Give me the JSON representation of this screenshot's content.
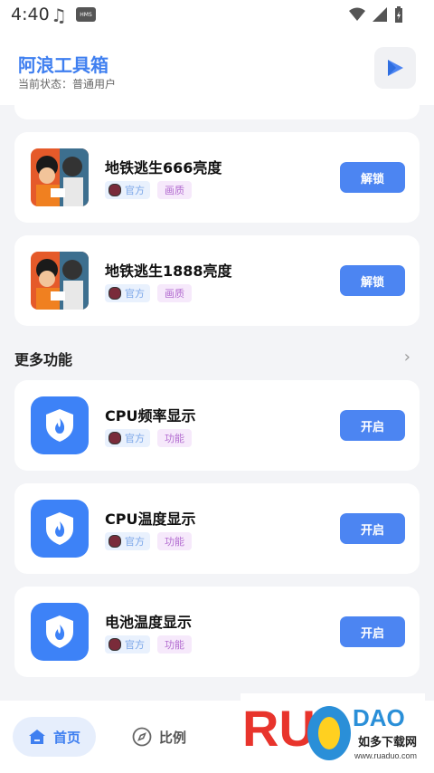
{
  "status": {
    "time": "4:40",
    "hms": "HMS"
  },
  "header": {
    "title": "阿浪工具箱",
    "subtitle": "当前状态：普通用户"
  },
  "games": [
    {
      "title": "地铁逃生666亮度",
      "tag_official": "官方",
      "tag_type": "画质",
      "button": "解锁"
    },
    {
      "title": "地铁逃生1888亮度",
      "tag_official": "官方",
      "tag_type": "画质",
      "button": "解锁"
    }
  ],
  "more": {
    "title": "更多功能"
  },
  "features": [
    {
      "title": "CPU频率显示",
      "tag_official": "官方",
      "tag_type": "功能",
      "button": "开启"
    },
    {
      "title": "CPU温度显示",
      "tag_official": "官方",
      "tag_type": "功能",
      "button": "开启"
    },
    {
      "title": "电池温度显示",
      "tag_official": "官方",
      "tag_type": "功能",
      "button": "开启"
    }
  ],
  "nav": {
    "home": "首页",
    "ratio": "比例"
  },
  "watermark": {
    "brand": "RUANDUO",
    "text": "如多下载网",
    "url": "www.ruaduo.com"
  },
  "colors": {
    "accent": "#3f7ff0",
    "button": "#4c85f2"
  }
}
